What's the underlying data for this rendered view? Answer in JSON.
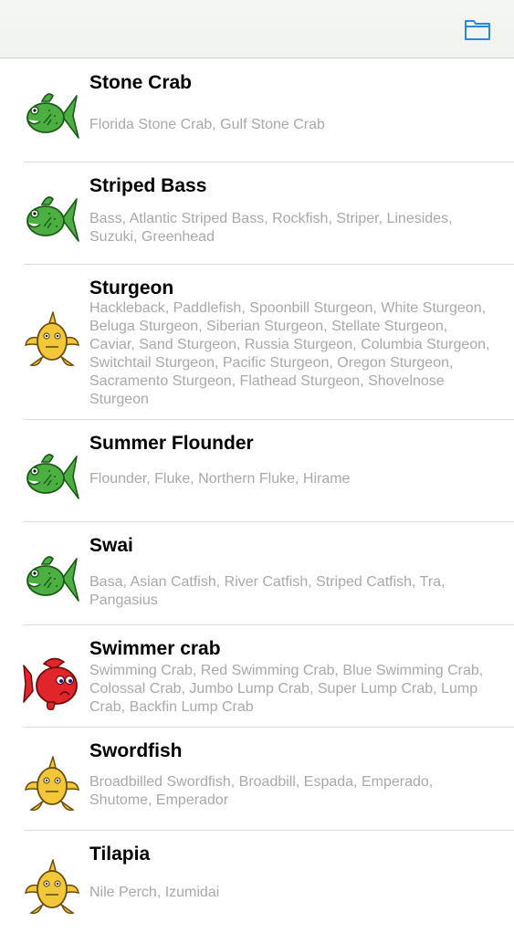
{
  "navbar": {
    "folder_icon": "folder-icon",
    "accent": "#2f86d6"
  },
  "items": [
    {
      "title": "Stone Crab",
      "subtitle": "Florida Stone Crab, Gulf Stone Crab",
      "rating": "best-choice",
      "icon": "green-fish-icon"
    },
    {
      "title": "Striped Bass",
      "subtitle": "Bass, Atlantic Striped Bass, Rockfish, Striper, Linesides, Suzuki, Greenhead",
      "rating": "best-choice",
      "icon": "green-fish-icon"
    },
    {
      "title": "Sturgeon",
      "subtitle": "Hackleback, Paddlefish, Spoonbill Sturgeon, White Sturgeon, Beluga Sturgeon, Siberian Sturgeon, Stellate Sturgeon, Caviar, Sand Sturgeon, Russia Sturgeon, Columbia Sturgeon, Switchtail Sturgeon, Pacific Sturgeon, Oregon Sturgeon, Sacramento Sturgeon, Flathead Sturgeon, Shovelnose Sturgeon",
      "rating": "good-alternative",
      "icon": "yellow-fish-icon"
    },
    {
      "title": "Summer Flounder",
      "subtitle": "Flounder, Fluke, Northern Fluke, Hirame",
      "rating": "best-choice",
      "icon": "green-fish-icon"
    },
    {
      "title": "Swai",
      "subtitle": "Basa, Asian Catfish, River Catfish, Striped Catfish, Tra, Pangasius",
      "rating": "best-choice",
      "icon": "green-fish-icon"
    },
    {
      "title": "Swimmer crab",
      "subtitle": "Swimming Crab, Red Swimming Crab, Blue Swimming Crab, Colossal Crab, Jumbo Lump Crab, Super Lump Crab, Lump Crab, Backfin Lump Crab",
      "rating": "avoid",
      "icon": "red-fish-icon"
    },
    {
      "title": "Swordfish",
      "subtitle": "Broadbilled Swordfish, Broadbill, Espada, Emperado, Shutome, Emperador",
      "rating": "good-alternative",
      "icon": "yellow-fish-icon"
    },
    {
      "title": "Tilapia",
      "subtitle": "Nile Perch, Izumidai",
      "rating": "good-alternative",
      "icon": "yellow-fish-icon"
    }
  ],
  "colors": {
    "green": "#4caf42",
    "yellow": "#f2c83a",
    "red": "#e0262a",
    "subtitle": "#a8a8ad"
  }
}
